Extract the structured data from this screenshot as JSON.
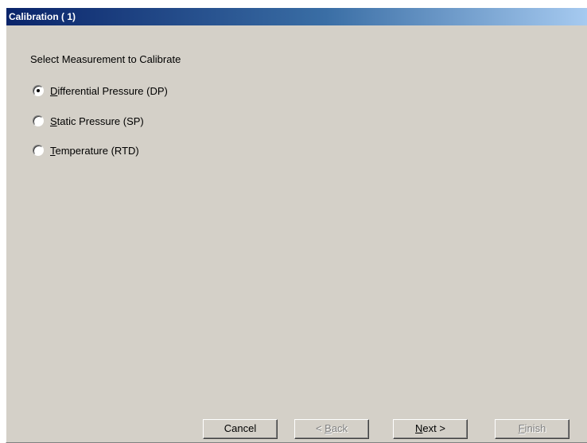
{
  "window": {
    "title": "Calibration ( 1)"
  },
  "prompt": "Select Measurement to Calibrate",
  "options": [
    {
      "mnemonic": "D",
      "rest": "ifferential Pressure (DP)",
      "selected": true
    },
    {
      "mnemonic": "S",
      "rest": "tatic  Pressure (SP)",
      "selected": false
    },
    {
      "mnemonic": "T",
      "rest": "emperature (RTD)",
      "selected": false
    }
  ],
  "buttons": {
    "cancel": {
      "label": "Cancel",
      "enabled": true
    },
    "back": {
      "prefix": "< ",
      "mnemonic": "B",
      "rest": "ack",
      "enabled": false
    },
    "next": {
      "mnemonic": "N",
      "rest": "ext >",
      "enabled": true
    },
    "finish": {
      "mnemonic": "F",
      "rest": "inish",
      "enabled": false
    }
  }
}
